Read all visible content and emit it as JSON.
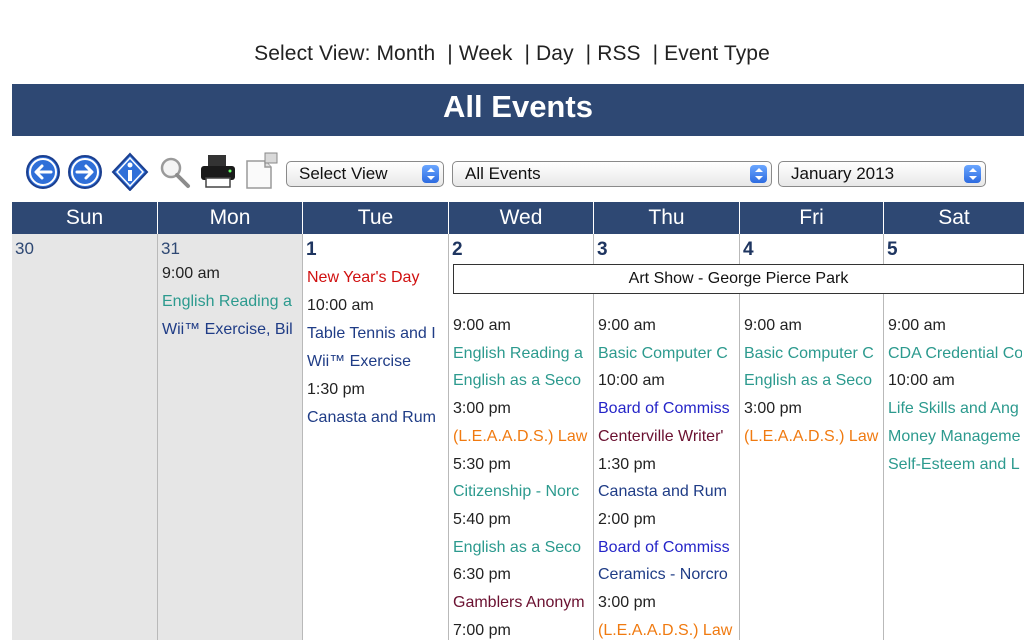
{
  "viewbar": {
    "prefix": "Select View:",
    "links": [
      "Month",
      "Week",
      "Day",
      "RSS",
      "Event Type"
    ]
  },
  "title": "All Events",
  "toolbar": {
    "icons": [
      "back-arrow-icon",
      "forward-arrow-icon",
      "info-icon",
      "search-icon",
      "print-icon",
      "subscribe-icon"
    ],
    "select_view": "Select View",
    "event_filter": "All Events",
    "month": "January 2013"
  },
  "colors": {
    "header": "#2e4873",
    "teal": "#2c9a8e",
    "navy": "#1f3c86",
    "red": "#d01010",
    "blue": "#2525c8",
    "orange": "#f07a10",
    "maroon": "#6a1030"
  },
  "days": [
    "Sun",
    "Mon",
    "Tue",
    "Wed",
    "Thu",
    "Fri",
    "Sat"
  ],
  "banner": "Art Show - George Pierce Park",
  "cells": [
    {
      "num": "30",
      "entries": []
    },
    {
      "num": "31",
      "entries": [
        {
          "text": "9:00 am",
          "kind": "time"
        },
        {
          "text": "English Reading a",
          "kind": "teal"
        },
        {
          "text": "Wii™ Exercise, Bil",
          "kind": "navy"
        }
      ]
    },
    {
      "num": "1",
      "entries": [
        {
          "text": "New Year's Day",
          "kind": "red"
        },
        {
          "text": "10:00 am",
          "kind": "time"
        },
        {
          "text": "Table Tennis and I",
          "kind": "navy"
        },
        {
          "text": "Wii™ Exercise",
          "kind": "navy"
        },
        {
          "text": "1:30 pm",
          "kind": "time"
        },
        {
          "text": "Canasta and Rum",
          "kind": "navy"
        }
      ]
    },
    {
      "num": "2",
      "entries": [
        {
          "text": "9:00 am",
          "kind": "time"
        },
        {
          "text": "English Reading a",
          "kind": "teal"
        },
        {
          "text": "English as a Seco",
          "kind": "teal"
        },
        {
          "text": "3:00 pm",
          "kind": "time"
        },
        {
          "text": "(L.E.A.A.D.S.) Law",
          "kind": "orange"
        },
        {
          "text": "5:30 pm",
          "kind": "time"
        },
        {
          "text": "Citizenship - Norc",
          "kind": "teal"
        },
        {
          "text": "5:40 pm",
          "kind": "time"
        },
        {
          "text": "English as a Seco",
          "kind": "teal"
        },
        {
          "text": "6:30 pm",
          "kind": "time"
        },
        {
          "text": "Gamblers Anonym",
          "kind": "maroon"
        },
        {
          "text": "7:00 pm",
          "kind": "time"
        }
      ]
    },
    {
      "num": "3",
      "entries": [
        {
          "text": "9:00 am",
          "kind": "time"
        },
        {
          "text": "Basic Computer C",
          "kind": "teal"
        },
        {
          "text": "10:00 am",
          "kind": "time"
        },
        {
          "text": "Board of Commiss",
          "kind": "blue"
        },
        {
          "text": "Centerville Writer'",
          "kind": "maroon"
        },
        {
          "text": "1:30 pm",
          "kind": "time"
        },
        {
          "text": "Canasta and Rum",
          "kind": "navy"
        },
        {
          "text": "2:00 pm",
          "kind": "time"
        },
        {
          "text": "Board of Commiss",
          "kind": "blue"
        },
        {
          "text": "Ceramics - Norcro",
          "kind": "navy"
        },
        {
          "text": "3:00 pm",
          "kind": "time"
        },
        {
          "text": "(L.E.A.A.D.S.) Law",
          "kind": "orange"
        }
      ]
    },
    {
      "num": "4",
      "entries": [
        {
          "text": "9:00 am",
          "kind": "time"
        },
        {
          "text": "Basic Computer C",
          "kind": "teal"
        },
        {
          "text": "English as a Seco",
          "kind": "teal"
        },
        {
          "text": "3:00 pm",
          "kind": "time"
        },
        {
          "text": "(L.E.A.A.D.S.) Law",
          "kind": "orange"
        }
      ]
    },
    {
      "num": "5",
      "entries": [
        {
          "text": "9:00 am",
          "kind": "time"
        },
        {
          "text": "CDA Credential Co",
          "kind": "teal"
        },
        {
          "text": "10:00 am",
          "kind": "time"
        },
        {
          "text": "Life Skills and Ang",
          "kind": "teal"
        },
        {
          "text": "Money Manageme",
          "kind": "teal"
        },
        {
          "text": "Self-Esteem and L",
          "kind": "teal"
        }
      ]
    }
  ]
}
